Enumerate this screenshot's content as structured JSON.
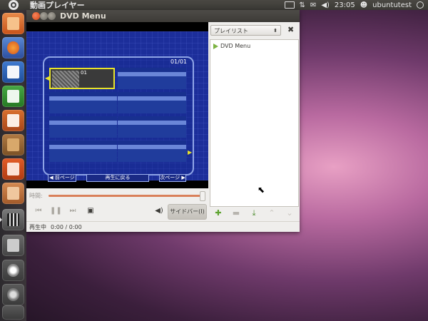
{
  "top_panel": {
    "app_title": "動画プレイヤー",
    "clock": "23:05",
    "user": "ubuntutest"
  },
  "launcher": {
    "items": [
      "home-folder",
      "firefox",
      "writer",
      "calc",
      "impress",
      "software-center",
      "ubuntu-one",
      "workspaces-or-app",
      "movie-player",
      "workspace-switcher",
      "search",
      "applications",
      "trash-or-drive"
    ]
  },
  "window": {
    "title": "DVD Menu"
  },
  "dvd_menu": {
    "page": "01/01",
    "selected_number": "01",
    "prev_label": "◀ 前ページ",
    "return_label": "再生に戻る",
    "next_label": "次ページ ▶"
  },
  "player": {
    "time_label": "時間:",
    "sidebar_button": "サイドバー(I)",
    "status": "再生中",
    "time": "0:00 / 0:00"
  },
  "playlist": {
    "selector": "プレイリスト",
    "items": [
      "DVD Menu"
    ]
  }
}
